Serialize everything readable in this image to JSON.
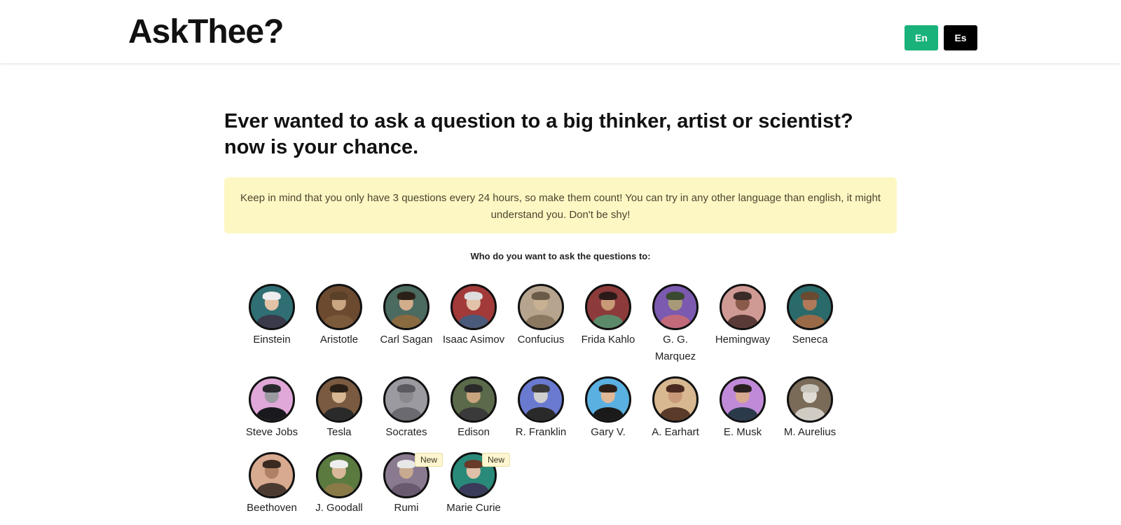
{
  "header": {
    "brand": "AskThee?",
    "lang_en": "En",
    "lang_es": "Es"
  },
  "main": {
    "headline": "Ever wanted to ask a question to a big thinker, artist or scientist? now is your chance.",
    "notice": "Keep in mind that you only have 3 questions every 24 hours, so make them count!  You can try in any other language than english, it might understand you. Don't be shy!",
    "prompt": "Who do you want to ask the questions to:"
  },
  "people": [
    {
      "name": "Einstein",
      "bg": "#2f6f73",
      "skin": "#e3c3a6",
      "hair": "#eeeeee",
      "shirt": "#3a3a4a"
    },
    {
      "name": "Aristotle",
      "bg": "#6b4a30",
      "skin": "#c9a582",
      "hair": "#5a4028",
      "shirt": "#7a5a3a"
    },
    {
      "name": "Carl Sagan",
      "bg": "#4b6a60",
      "skin": "#d2ad8c",
      "hair": "#2a2018",
      "shirt": "#8a6a40"
    },
    {
      "name": "Isaac Asimov",
      "bg": "#a23a3a",
      "skin": "#e2c2a8",
      "hair": "#dddddd",
      "shirt": "#4a5a7a"
    },
    {
      "name": "Confucius",
      "bg": "#b6a48e",
      "skin": "#c8b092",
      "hair": "#6a5a48",
      "shirt": "#8c7860"
    },
    {
      "name": "Frida Kahlo",
      "bg": "#8c3a3a",
      "skin": "#c99a78",
      "hair": "#2a1a18",
      "shirt": "#5a8a6a"
    },
    {
      "name": "G. G. Marquez",
      "bg": "#7b5ab0",
      "skin": "#a89a78",
      "hair": "#3a4a30",
      "shirt": "#c26a7a"
    },
    {
      "name": "Hemingway",
      "bg": "#d09a94",
      "skin": "#8a5a4a",
      "hair": "#3a2a28",
      "shirt": "#5a3a36"
    },
    {
      "name": "Seneca",
      "bg": "#2a6a6a",
      "skin": "#b07a5a",
      "hair": "#6a4a30",
      "shirt": "#9a6a48"
    },
    {
      "name": "Steve Jobs",
      "bg": "#e0a8d8",
      "skin": "#9a9aa0",
      "hair": "#2a2a2e",
      "shirt": "#1a1a1e"
    },
    {
      "name": "Tesla",
      "bg": "#7a5a40",
      "skin": "#d8b894",
      "hair": "#2a2018",
      "shirt": "#2a2a2a"
    },
    {
      "name": "Socrates",
      "bg": "#9a9aa0",
      "skin": "#8a8a8e",
      "hair": "#5a5a60",
      "shirt": "#6a6a70"
    },
    {
      "name": "Edison",
      "bg": "#5a6a4a",
      "skin": "#c8a47e",
      "hair": "#2a2a2a",
      "shirt": "#3a3a3a"
    },
    {
      "name": "R. Franklin",
      "bg": "#6a7ad0",
      "skin": "#cfcfcf",
      "hair": "#3a3a3a",
      "shirt": "#2a2a2a"
    },
    {
      "name": "Gary V.",
      "bg": "#5ab0e0",
      "skin": "#e0b898",
      "hair": "#2a2018",
      "shirt": "#1a1a1a"
    },
    {
      "name": "A. Earhart",
      "bg": "#d8b890",
      "skin": "#c89878",
      "hair": "#4a2a20",
      "shirt": "#5a3a28"
    },
    {
      "name": "E. Musk",
      "bg": "#c08ad8",
      "skin": "#d8a890",
      "hair": "#2a2020",
      "shirt": "#2a3a4a"
    },
    {
      "name": "M. Aurelius",
      "bg": "#7a6a58",
      "skin": "#e0dcd4",
      "hair": "#c8c4bc",
      "shirt": "#d0ccc4"
    },
    {
      "name": "Beethoven",
      "bg": "#d8aa90",
      "skin": "#b08064",
      "hair": "#3a2a20",
      "shirt": "#4a3a30"
    },
    {
      "name": "J. Goodall",
      "bg": "#5a7a40",
      "skin": "#d8b898",
      "hair": "#eeeeee",
      "shirt": "#8a7a48"
    },
    {
      "name": "Rumi",
      "bg": "#8a7a90",
      "skin": "#c8aa90",
      "hair": "#e8e8e8",
      "shirt": "#6a5a70",
      "badge": "New"
    },
    {
      "name": "Marie Curie",
      "bg": "#2a8a7a",
      "skin": "#e0c0a8",
      "hair": "#6a3a2a",
      "shirt": "#3a3a5a",
      "badge": "New"
    }
  ]
}
